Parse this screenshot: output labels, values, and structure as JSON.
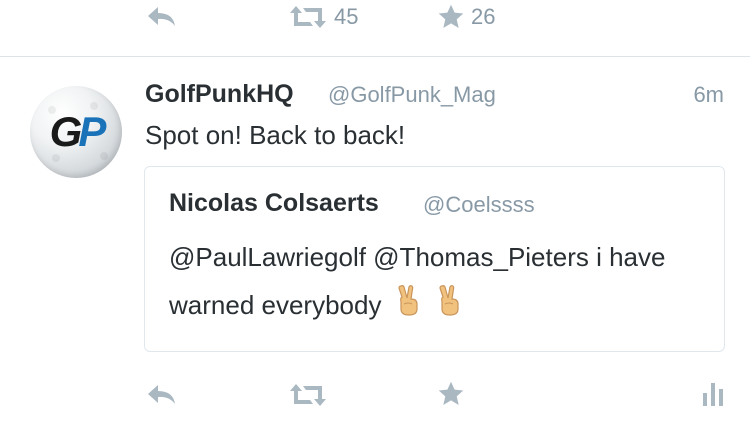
{
  "previous_tweet_actions": {
    "retweet_count": "45",
    "like_count": "26"
  },
  "tweet": {
    "display_name": "GolfPunkHQ",
    "handle": "@GolfPunk_Mag",
    "timestamp": "6m",
    "text": "Spot on! Back to back!",
    "avatar_logo": "GP",
    "quoted": {
      "display_name": "Nicolas Colsaerts",
      "handle": "@Coelssss",
      "text": "@PaulLawriegolf @Thomas_Pieters i have warned everybody",
      "emoji": [
        "victory-hand",
        "victory-hand"
      ]
    }
  },
  "icons": [
    "reply-icon",
    "retweet-icon",
    "like-star-icon",
    "analytics-icon"
  ],
  "colors": {
    "icon_gray": "#aab8c2",
    "meta_gray": "#8899a6",
    "text": "#292f33",
    "divider": "#dfe3e6",
    "logo_blue": "#1a73b8"
  }
}
